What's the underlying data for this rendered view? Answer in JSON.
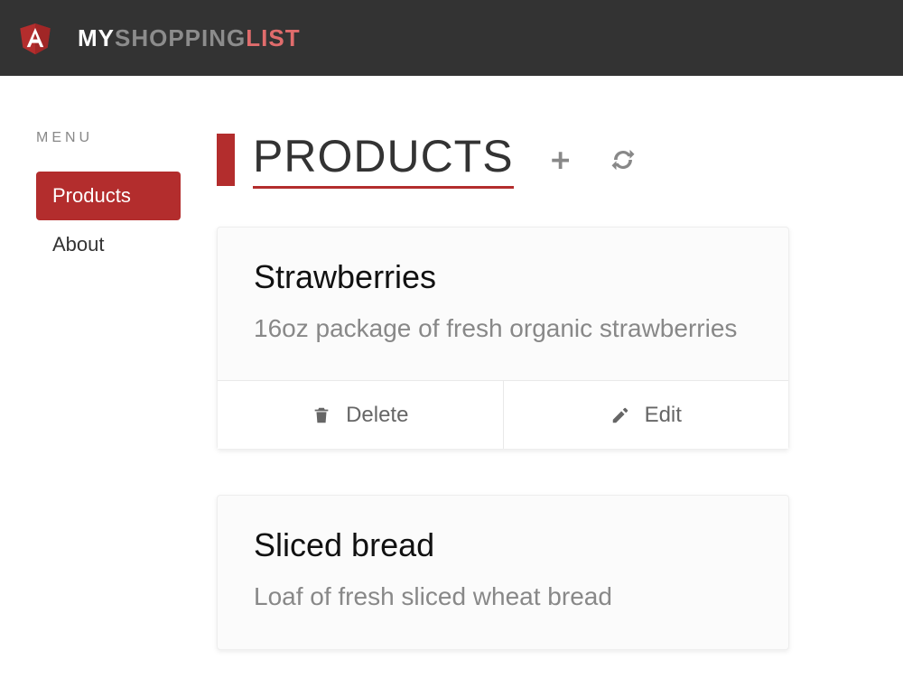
{
  "brand": {
    "part1": "MY",
    "part2": "SHOPPING",
    "part3": "LIST"
  },
  "sidebar": {
    "menu_label": "MENU",
    "items": [
      {
        "label": "Products",
        "active": true
      },
      {
        "label": "About",
        "active": false
      }
    ]
  },
  "page": {
    "title": "PRODUCTS",
    "add_icon": "plus",
    "refresh_icon": "refresh"
  },
  "actions": {
    "delete": "Delete",
    "edit": "Edit"
  },
  "products": [
    {
      "title": "Strawberries",
      "description": "16oz package of fresh organic strawberries"
    },
    {
      "title": "Sliced bread",
      "description": "Loaf of fresh sliced wheat bread"
    }
  ],
  "colors": {
    "accent": "#b32d2d",
    "header_bg": "#333333"
  }
}
